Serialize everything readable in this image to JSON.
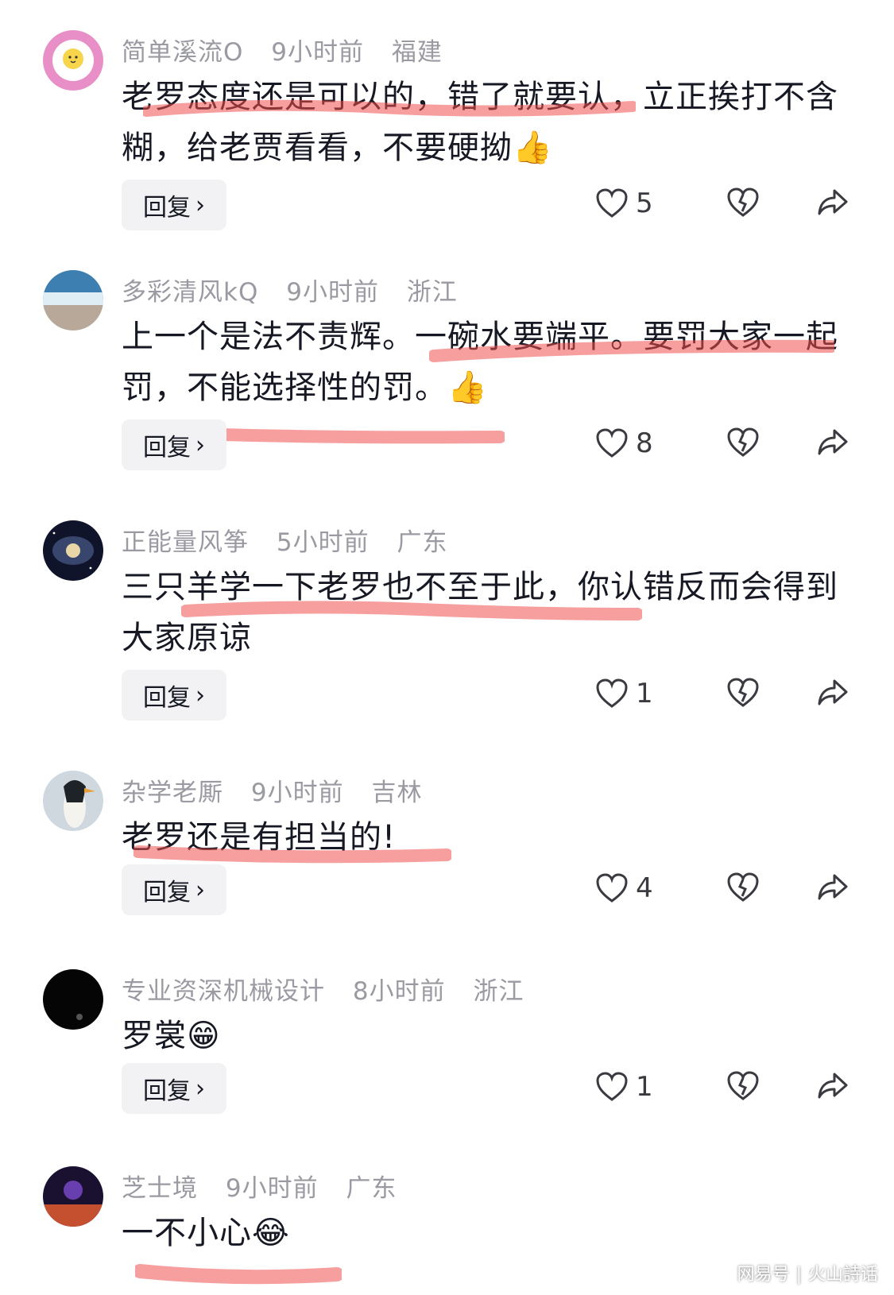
{
  "comments": [
    {
      "username": "简单溪流O",
      "time": "9小时前",
      "location": "福建",
      "text": "老罗态度还是可以的，错了就要认，立正挨打不含糊，给老贾看看，不要硬拗",
      "emoji": "👍",
      "likes": "5",
      "reply_label": "回复"
    },
    {
      "username": "多彩清风kQ",
      "time": "9小时前",
      "location": "浙江",
      "text": "上一个是法不责辉。一碗水要端平。要罚大家一起罚，不能选择性的罚。",
      "emoji": "👍",
      "likes": "8",
      "reply_label": "回复"
    },
    {
      "username": "正能量风筝",
      "time": "5小时前",
      "location": "广东",
      "text": "三只羊学一下老罗也不至于此，你认错反而会得到大家原谅",
      "emoji": "",
      "likes": "1",
      "reply_label": "回复"
    },
    {
      "username": "杂学老厮",
      "time": "9小时前",
      "location": "吉林",
      "text": "老罗还是有担当的!",
      "emoji": "",
      "likes": "4",
      "reply_label": "回复"
    },
    {
      "username": "专业资深机械设计",
      "time": "8小时前",
      "location": "浙江",
      "text": "罗裳",
      "emoji": "😁",
      "likes": "1",
      "reply_label": "回复"
    },
    {
      "username": "芝士境",
      "time": "9小时前",
      "location": "广东",
      "text": "一不小心",
      "emoji": "😂",
      "likes": "",
      "reply_label": ""
    }
  ],
  "watermark": {
    "left": "网易号",
    "right": "火山詩话"
  },
  "colors": {
    "highlight": "#f0504f",
    "meta": "#9a9aa2",
    "reply_bg": "#f2f2f4"
  }
}
